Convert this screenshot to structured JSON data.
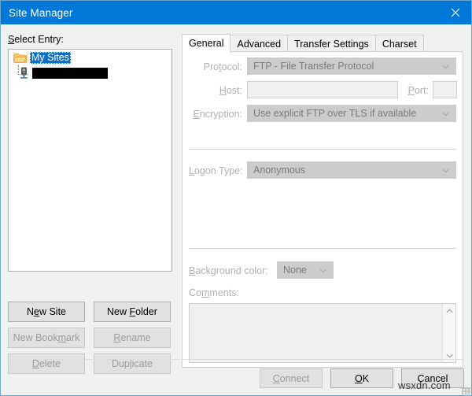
{
  "window": {
    "title": "Site Manager",
    "close_label": "×",
    "close_icon": "close-icon"
  },
  "left_pane": {
    "select_entry_label": "Select Entry:",
    "tree": {
      "root": {
        "label": "My Sites",
        "icon": "folder-icon",
        "selected": true
      },
      "children": [
        {
          "label": "",
          "redacted": true,
          "icon": "server-icon",
          "selected": false
        }
      ]
    },
    "buttons": [
      {
        "label": "New Site",
        "enabled": true
      },
      {
        "label": "New Folder",
        "enabled": true
      },
      {
        "label": "New Bookmark",
        "enabled": false
      },
      {
        "label": "Rename",
        "enabled": false
      },
      {
        "label": "Delete",
        "enabled": false
      },
      {
        "label": "Duplicate",
        "enabled": false
      }
    ]
  },
  "tabs": [
    {
      "label": "General",
      "active": true
    },
    {
      "label": "Advanced",
      "active": false
    },
    {
      "label": "Transfer Settings",
      "active": false
    },
    {
      "label": "Charset",
      "active": false
    }
  ],
  "general_tab": {
    "protocol": {
      "label": "Protocol:",
      "value": "FTP - File Transfer Protocol",
      "enabled": false
    },
    "host": {
      "label": "Host:",
      "value": "",
      "enabled": false
    },
    "port": {
      "label": "Port:",
      "value": "",
      "enabled": false
    },
    "encryption": {
      "label": "Encryption:",
      "value": "Use explicit FTP over TLS if available",
      "enabled": false
    },
    "logon_type": {
      "label": "Logon Type:",
      "value": "Anonymous",
      "enabled": false
    },
    "background_color": {
      "label": "Background color:",
      "value": "None",
      "enabled": false
    },
    "comments": {
      "label": "Comments:",
      "value": "",
      "enabled": false
    }
  },
  "footer": {
    "buttons": [
      {
        "label": "Connect",
        "enabled": false
      },
      {
        "label": "OK",
        "enabled": true
      },
      {
        "label": "Cancel",
        "enabled": true
      }
    ]
  },
  "watermark": {
    "text": "wsxdn.com"
  },
  "colors": {
    "titlebar": "#0078d7",
    "selection": "#0c6fc4",
    "dialog_bg": "#f0f0f0",
    "panel_bg": "#ffffff",
    "button_bg": "#e1e1e1",
    "disabled_text": "#9a9a9a",
    "folder_icon": "#f6b73c"
  }
}
